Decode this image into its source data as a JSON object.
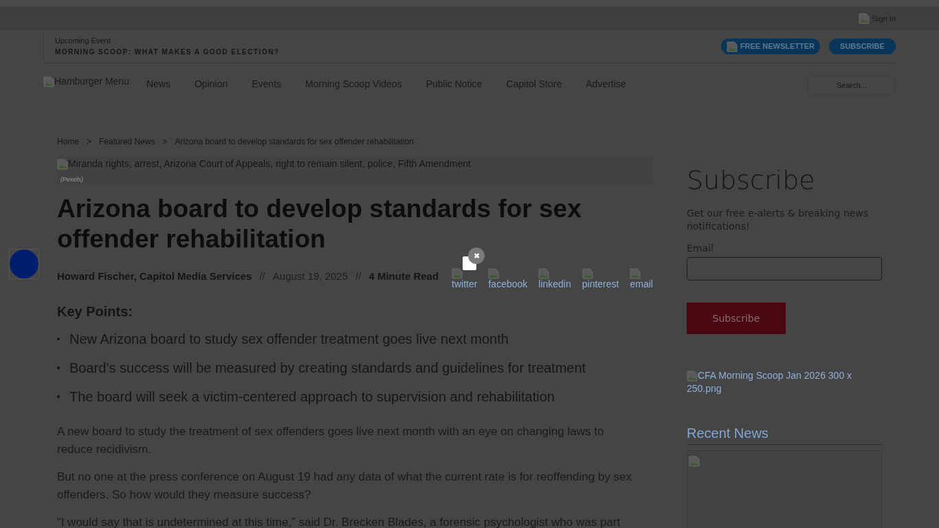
{
  "top_bar": {
    "sign_in": "Sign In"
  },
  "event": {
    "label": "Upcoming Event",
    "title": "MORNING SCOOP: WHAT MAKES A GOOD ELECTION?"
  },
  "header_buttons": [
    {
      "label": "FREE NEWSLETTER",
      "kind": "icon"
    },
    {
      "label": "SUBSCRIBE",
      "kind": "plain"
    }
  ],
  "nav": {
    "menu_alt": "Hamburger Menu",
    "items": [
      "News",
      "Opinion",
      "Events",
      "Morning Scoop Videos",
      "Public Notice",
      "Capitol Store",
      "Advertise"
    ],
    "search_placeholder": "Search..."
  },
  "breadcrumb": [
    "Home",
    "Featured News",
    "Arizona board to develop standards for sex offender rehabilitation"
  ],
  "breadcrumb_separator": ">",
  "article": {
    "image_alt": "Miranda rights, arrest, Arizona Court of Appeals, right to remain silent, police, Fifth Amendment",
    "caption": "(Pexels)",
    "title": "Arizona board to develop standards for sex offender rehabilitation",
    "author": "Howard Fischer, Capitol Media Services",
    "separator": "//",
    "date": "August 19, 2025",
    "read_time": "4 Minute Read",
    "share": [
      "twitter",
      "facebook",
      "linkedin",
      "pinterest",
      "email"
    ],
    "key_points_title": "Key Points:",
    "key_points": [
      "New Arizona board to study sex offender treatment goes live next month",
      "Board’s success will be measured by creating standards and guidelines for treatment",
      "The board will seek a victim-centered approach to supervision and rehabilitation"
    ],
    "paragraphs": [
      "A new board to study the treatment of sex offenders goes live next month with an eye on changing laws to reduce recidivism.",
      "But no one at the press conference on August 19 had any data of what the current rate is for reoffending by sex offenders. So how would they measure success?",
      "“I would say that is undetermined at this time,” said Dr. Brecken Blades, a forensic psychologist who was part"
    ]
  },
  "sidebar": {
    "subscribe_title": "Subscribe",
    "subscribe_text": "Get our free e-alerts & breaking news notifications!",
    "email_label": "Email",
    "subscribe_button": "Subscribe",
    "ad_alt": "CFA Morning Scoop Jan 2026 300 x 250.png",
    "recent_title": "Recent News"
  },
  "popup": {
    "close": "✖"
  }
}
